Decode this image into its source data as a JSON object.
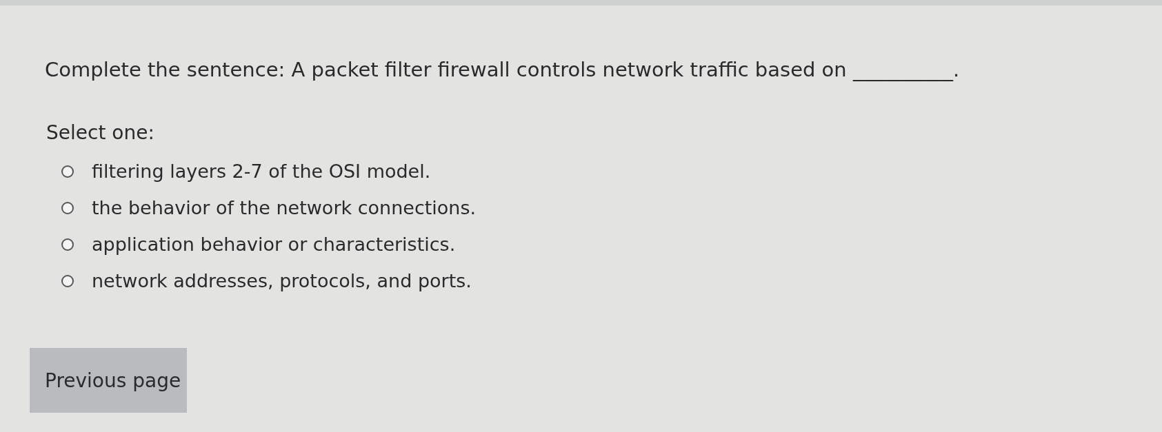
{
  "question": {
    "text": "Complete the sentence: A packet filter firewall controls network traffic based on __________."
  },
  "prompt": "Select one:",
  "options": [
    {
      "label": "filtering layers 2-7 of the OSI model.",
      "selected": false
    },
    {
      "label": "the behavior of the network connections.",
      "selected": false
    },
    {
      "label": "application behavior or characteristics.",
      "selected": false
    },
    {
      "label": "network addresses, protocols, and ports.",
      "selected": false
    }
  ],
  "buttons": [
    {
      "label": "Previous page"
    }
  ]
}
